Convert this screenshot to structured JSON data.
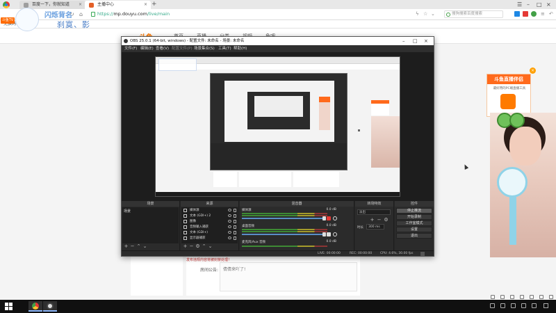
{
  "browser": {
    "tabs": [
      {
        "label": "百度一下，你就知道",
        "close": "×"
      },
      {
        "label": "主播中心",
        "close": "×"
      }
    ],
    "new_tab": "+",
    "address": {
      "scheme": "https://",
      "host": "mp.douyu.com",
      "path": "/live/main"
    },
    "search_placeholder": "搜狗搜索百度搜索",
    "nav": {
      "back": "‹",
      "forward": "›",
      "refresh": "↻",
      "home": "⌂"
    },
    "window_controls": {
      "minimize": "–",
      "maximize": "□",
      "close": "×"
    },
    "bookmarks": [
      "兑换码"
    ]
  },
  "watermark": {
    "logo": "斗鱼TV",
    "line1": "闪烁背名",
    "line2": "刹寞、影"
  },
  "page": {
    "logo": "斗鱼",
    "nav": [
      "首页",
      "直播",
      "分类",
      "视频",
      "鱼吧"
    ],
    "announce_label": "房间公告:",
    "announce_text": "倩倩来吖了!",
    "red_notice": "发布违规内容将被封禁处理！",
    "promo": {
      "title": "斗鱼直播伴侣",
      "subtitle": "最好用的PC端直播工具",
      "close": "×"
    }
  },
  "obs": {
    "title": "OBS 25.0.1 (64-bit, windows) - 配置文件: 未命名 - 场景: 未命名",
    "menu": [
      "文件(F)",
      "编辑(E)",
      "查看(V)",
      "配置文件(P)",
      "场景集合(S)",
      "工具(T)",
      "帮助(H)"
    ],
    "docks": {
      "scenes": {
        "title": "场景",
        "items": [
          "场景"
        ]
      },
      "sources": {
        "title": "来源",
        "items": [
          "媒体源",
          "文本 (GDI+) 2",
          "图像",
          "音频输入捕获",
          "文本 (GDI+)",
          "显示器捕获"
        ]
      },
      "mixer": {
        "title": "混音器",
        "tracks": [
          {
            "name": "媒体源",
            "db": "0.0 dB",
            "muted": true
          },
          {
            "name": "桌面音频",
            "db": "0.0 dB",
            "muted": false
          },
          {
            "name": "麦克风/Aux 音频",
            "db": "0.0 dB",
            "muted": false
          }
        ]
      },
      "transitions": {
        "title": "转场特效",
        "type": "淡出",
        "duration_label": "时长",
        "duration": "300 ms"
      },
      "controls": {
        "title": "控件",
        "buttons": [
          "停止推流",
          "开始录制",
          "工作室模式",
          "设置",
          "退出"
        ]
      }
    },
    "status": {
      "live": "LIVE: 00:00:00",
      "rec": "REC: 00:00:00",
      "cpu": "CPU: 4.6%, 30.00 fps"
    }
  },
  "taskbar": {
    "apps": [
      "chrome",
      "obs"
    ]
  }
}
